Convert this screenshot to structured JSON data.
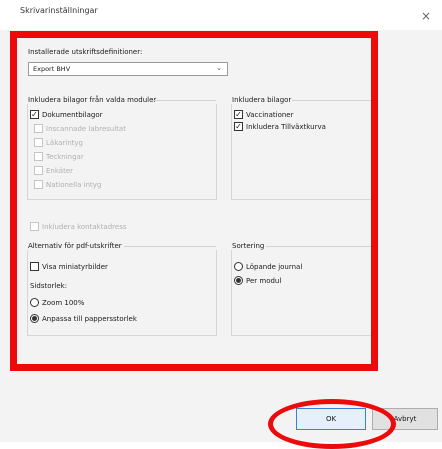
{
  "window": {
    "title": "Skrivarinställningar",
    "close_glyph": "×"
  },
  "print_definitions": {
    "label": "Installerade utskriftsdefinitioner:",
    "selected": "Export BHV",
    "arrow_glyph": "⌄"
  },
  "modules_group": {
    "label": "Inkludera bilagor från valda moduler",
    "items": [
      {
        "label": "Dokumentbilagor",
        "checked": true,
        "enabled": true
      },
      {
        "label": "Inscannade labresultat",
        "checked": false,
        "enabled": false
      },
      {
        "label": "Läkarintyg",
        "checked": false,
        "enabled": false
      },
      {
        "label": "Teckningar",
        "checked": false,
        "enabled": false
      },
      {
        "label": "Enkäter",
        "checked": false,
        "enabled": false
      },
      {
        "label": "Nationella intyg",
        "checked": false,
        "enabled": false
      }
    ]
  },
  "attachments_group": {
    "label": "Inkludera bilagor",
    "items": [
      {
        "label": "Vaccinationer",
        "checked": true
      },
      {
        "label": "Inkludera Tillväxtkurva",
        "checked": true
      }
    ]
  },
  "contact": {
    "label": "Inkludera kontaktadress",
    "checked": false,
    "enabled": false
  },
  "pdf_group": {
    "label": "Alternativ för pdf-utskrifter",
    "thumbnails_label": "Visa miniatyrbilder",
    "thumbnails_checked": false,
    "page_size_label": "Sidstorlek:",
    "options": [
      {
        "label": "Zoom 100%",
        "selected": false
      },
      {
        "label": "Anpassa till pappersstorlek",
        "selected": true
      }
    ]
  },
  "sort_group": {
    "label": "Sortering",
    "options": [
      {
        "label": "Löpande journal",
        "selected": false
      },
      {
        "label": "Per modul",
        "selected": true
      }
    ]
  },
  "buttons": {
    "ok": "OK",
    "cancel": "Avbryt"
  },
  "check_glyph": "✓",
  "colors": {
    "annotation": "#ec0a0a",
    "accent": "#3c7fd6"
  }
}
